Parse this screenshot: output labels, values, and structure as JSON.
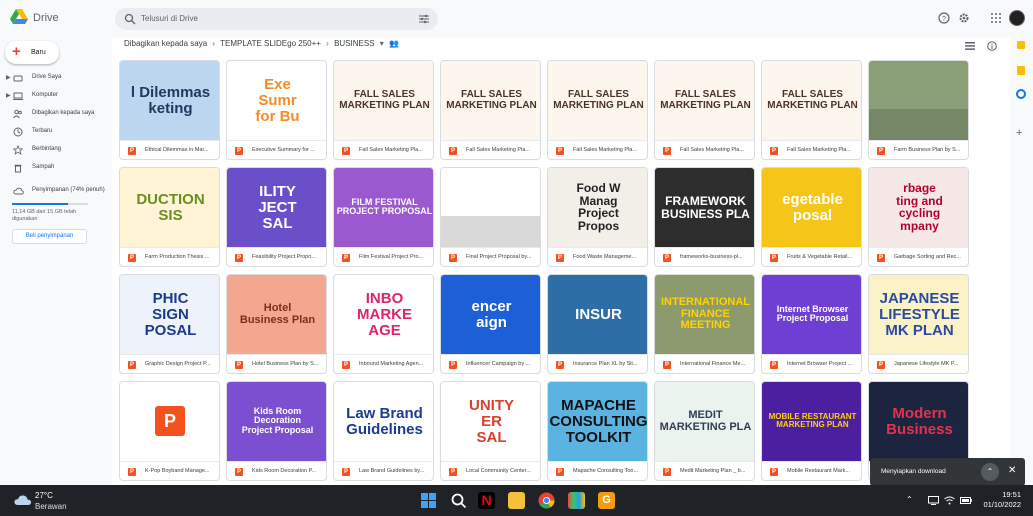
{
  "app": {
    "name": "Drive"
  },
  "search": {
    "placeholder": "Telusuri di Drive"
  },
  "sidebar": {
    "new_label": "Baru",
    "items": [
      {
        "label": "Drive Saya",
        "icon": "drive-icon"
      },
      {
        "label": "Komputer",
        "icon": "computer-icon"
      },
      {
        "label": "Dibagikan kepada saya",
        "icon": "shared-icon"
      },
      {
        "label": "Terbaru",
        "icon": "clock-icon"
      },
      {
        "label": "Berbintang",
        "icon": "star-icon"
      },
      {
        "label": "Sampah",
        "icon": "trash-icon"
      }
    ],
    "storage_label": "Penyimpanan (74% penuh)",
    "storage_used_fraction": 0.74,
    "storage_text": "11,14 GB dari 15 GB telah digunakan",
    "buy_label": "Beli penyimpanan"
  },
  "breadcrumb": {
    "items": [
      "Dibagikan kepada saya",
      "TEMPLATE SLIDEgo 250++",
      "BUSINESS"
    ]
  },
  "files": [
    {
      "name": "Ethical Dilemmas in Mar...",
      "thumb_text": "l Dilemmas\nketing",
      "bg": "#bcd6f0",
      "fg": "#1f3a60"
    },
    {
      "name": "Executive Summary for ...",
      "thumb_text": "Exe\nSumr\nfor Bu",
      "bg": "#ffffff",
      "fg": "#f28c28"
    },
    {
      "name": "Fall Sales Marketing Pla...",
      "thumb_text": "FALL SALES\nMARKETING PLAN",
      "bg": "#fdf6ee",
      "fg": "#4a3328"
    },
    {
      "name": "Fall Sales Marketing Pla...",
      "thumb_text": "FALL SALES\nMARKETING PLAN",
      "bg": "#fdf6ee",
      "fg": "#4a3328"
    },
    {
      "name": "Fall Sales Marketing Pla...",
      "thumb_text": "FALL SALES\nMARKETING PLAN",
      "bg": "#fdf6ee",
      "fg": "#4a3328"
    },
    {
      "name": "Fall Sales Marketing Pla...",
      "thumb_text": "FALL SALES\nMARKETING PLAN",
      "bg": "#fdf6ee",
      "fg": "#4a3328"
    },
    {
      "name": "Fall Sales Marketing Pla...",
      "thumb_text": "FALL SALES\nMARKETING PLAN",
      "bg": "#fdf6ee",
      "fg": "#4a3328"
    },
    {
      "name": "Farm Business Plan by S...",
      "thumb_text": "",
      "bg": "#8a9f78",
      "fg": "#ffffff"
    },
    {
      "name": "Farm Production Thesis ...",
      "thumb_text": "DUCTION\nSIS",
      "bg": "#fff4d6",
      "fg": "#6b8e23"
    },
    {
      "name": "Feasibility Project Propo...",
      "thumb_text": "ILITY\nJECT\nSAL",
      "bg": "#6a4fc9",
      "fg": "#ffffff"
    },
    {
      "name": "Film Festival Project Pro...",
      "thumb_text": "FILM FESTIVAL\nPROJECT PROPOSAL",
      "bg": "#9b59d0",
      "fg": "#ffffff"
    },
    {
      "name": "Final Project Proposal by...",
      "thumb_text": "",
      "bg": "#ffffff",
      "fg": "#e74c3c"
    },
    {
      "name": "Food Waste Manageme...",
      "thumb_text": "Food W\nManag\nProject\nPropos",
      "bg": "#f2efe9",
      "fg": "#222222"
    },
    {
      "name": "frameworks-business-pl...",
      "thumb_text": "FRAMEWORK\nBUSINESS PLA",
      "bg": "#2d2d2d",
      "fg": "#ffffff"
    },
    {
      "name": "Fruits & Vegetable Retail...",
      "thumb_text": "egetable\nposal",
      "bg": "#f5c518",
      "fg": "#ffffff"
    },
    {
      "name": "Garbage Sorting and Rec...",
      "thumb_text": "rbage\nting and\ncycling\nmpany",
      "bg": "#f7e8e8",
      "fg": "#b3002d"
    },
    {
      "name": "Graphic Design Project P...",
      "thumb_text": "PHIC\nSIGN\nPOSAL",
      "bg": "#eef3fb",
      "fg": "#1b3a8a"
    },
    {
      "name": "Hotel Business Plan by S...",
      "thumb_text": "Hotel\nBusiness Plan",
      "bg": "#f4a78f",
      "fg": "#7a2e1e"
    },
    {
      "name": "Inbound Marketing Agen...",
      "thumb_text": "INBO\nMARKE\nAGE",
      "bg": "#ffffff",
      "fg": "#e0246c"
    },
    {
      "name": "Influencer Campaign by ...",
      "thumb_text": "encer\naign",
      "bg": "#1c5fd6",
      "fg": "#ffffff"
    },
    {
      "name": "Insurance Plan XL by Sli...",
      "thumb_text": "INSUR",
      "bg": "#2e6ea6",
      "fg": "#ffffff"
    },
    {
      "name": "International Finance Me...",
      "thumb_text": "INTERNATIONAL\nFINANCE\nMEETING",
      "bg": "#8c9a6e",
      "fg": "#ffd200"
    },
    {
      "name": "Internet Browser Project ...",
      "thumb_text": "Internet Browser\nProject Proposal",
      "bg": "#6f3fd3",
      "fg": "#ffffff"
    },
    {
      "name": "Japanese Lifestyle MK P...",
      "thumb_text": "JAPANESE\nLIFESTYLE\nMK PLAN",
      "bg": "#fbf3c7",
      "fg": "#2a4aa0"
    },
    {
      "name": "K-Pop Boyband Manage...",
      "thumb_text": "",
      "bg": "#ffffff",
      "fg": "#f4511e"
    },
    {
      "name": "Kids Room Decoration P...",
      "thumb_text": "Kids Room\nDecoration\nProject Proposal",
      "bg": "#7b4fd0",
      "fg": "#ffffff"
    },
    {
      "name": "Law Brand Guidelines by...",
      "thumb_text": "Law Brand\nGuidelines",
      "bg": "#ffffff",
      "fg": "#1d3c8f"
    },
    {
      "name": "Local Community Center...",
      "thumb_text": "UNITY\nER\nSAL",
      "bg": "#ffffff",
      "fg": "#d9412b"
    },
    {
      "name": "Mapache Consulting Too...",
      "thumb_text": "MAPACHE\nCONSULTING\nTOOLKIT",
      "bg": "#5ab3e0",
      "fg": "#111111"
    },
    {
      "name": "Medit Marketing Plan _ b...",
      "thumb_text": "MEDIT\nMARKETING PLA",
      "bg": "#eaf3ee",
      "fg": "#2f3e55"
    },
    {
      "name": "Mobile Restaurant Mark...",
      "thumb_text": "MOBILE RESTAURANT\nMARKETING PLAN",
      "bg": "#4b1fa0",
      "fg": "#ffd200"
    },
    {
      "name": "Modern Business",
      "thumb_text": "Modern\nBusiness",
      "bg": "#1d2440",
      "fg": "#e2334d"
    }
  ],
  "toast": {
    "text": "Menyiapkan download"
  },
  "taskbar": {
    "temp": "27°C",
    "condition": "Berawan",
    "time": "19:51",
    "date": "01/10/2022"
  }
}
